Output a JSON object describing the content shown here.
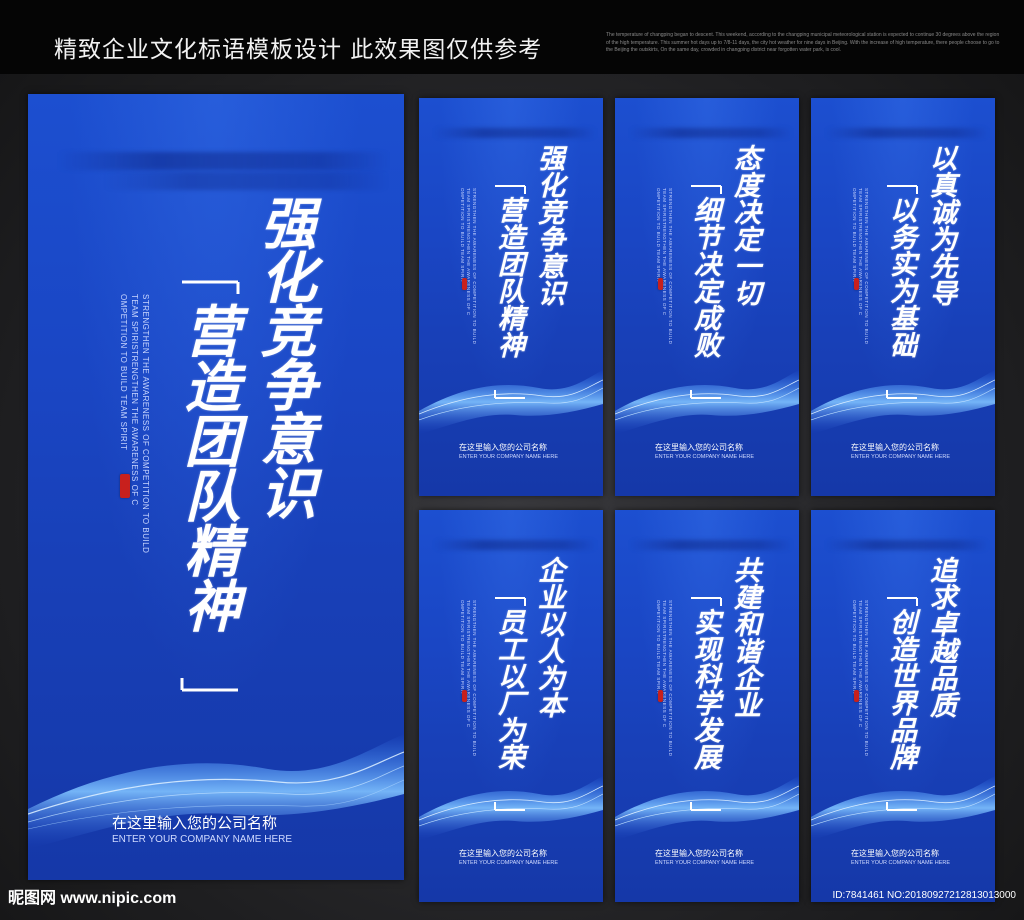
{
  "header": {
    "title": "精致企业文化标语模板设计 此效果图仅供参考",
    "fine_print": "The temperature of changping began to descent. This weekend, according to the changping municipal meteorological station is expected to continue 30 degrees above the region of the high temperature. This summer hot days up to 7/8-11 days, the city hot weather for nine days in Beijing. With the increase of high temperature, there people choose to go to the Beijing the outskirts, On the same day, crowded in changping district near forgotten water park, is cool."
  },
  "posters": [
    {
      "slogan_main": "强化竞争意识",
      "slogan_sub": "营造团队精神",
      "english_lines": [
        "STRENGTHEN THE AWARENESS OF COMPETITION TO BUILD",
        "TEAM SPIRISTRENGTHEN THE AWARENESS OF C",
        "OMPETITION TO BUILD TEAM SPIRIT"
      ],
      "company_cn": "在这里输入您的公司名称",
      "company_en": "ENTER YOUR COMPANY NAME HERE"
    },
    {
      "slogan_main": "强化竞争意识",
      "slogan_sub": "营造团队精神",
      "english_lines": [
        "STRENGTHEN THE AWARENESS OF COMPETITION TO BUILD",
        "TEAM SPIRISTRENGTHEN THE AWARENESS OF C",
        "OMPETITION TO BUILD TEAM SPIRIT"
      ],
      "company_cn": "在这里输入您的公司名称",
      "company_en": "ENTER YOUR COMPANY NAME HERE"
    },
    {
      "slogan_main": "态度决定一切",
      "slogan_sub": "细节决定成败",
      "english_lines": [
        "STRENGTHEN THE AWARENESS OF COMPETITION TO BUILD",
        "TEAM SPIRISTRENGTHEN THE AWARENESS OF C",
        "OMPETITION TO BUILD TEAM SPIRIT"
      ],
      "company_cn": "在这里输入您的公司名称",
      "company_en": "ENTER YOUR COMPANY NAME HERE"
    },
    {
      "slogan_main": "以真诚为先导",
      "slogan_sub": "以务实为基础",
      "english_lines": [
        "STRENGTHEN THE AWARENESS OF COMPETITION TO BUILD",
        "TEAM SPIRISTRENGTHEN THE AWARENESS OF C",
        "OMPETITION TO BUILD TEAM SPIRIT"
      ],
      "company_cn": "在这里输入您的公司名称",
      "company_en": "ENTER YOUR COMPANY NAME HERE"
    },
    {
      "slogan_main": "企业以人为本",
      "slogan_sub": "员工以厂为荣",
      "english_lines": [
        "STRENGTHEN THE AWARENESS OF COMPETITION TO BUILD",
        "TEAM SPIRISTRENGTHEN THE AWARENESS OF C",
        "OMPETITION TO BUILD TEAM SPIRIT"
      ],
      "company_cn": "在这里输入您的公司名称",
      "company_en": "ENTER YOUR COMPANY NAME HERE"
    },
    {
      "slogan_main": "共建和谐企业",
      "slogan_sub": "实现科学发展",
      "english_lines": [
        "STRENGTHEN THE AWARENESS OF COMPETITION TO BUILD",
        "TEAM SPIRISTRENGTHEN THE AWARENESS OF C",
        "OMPETITION TO BUILD TEAM SPIRIT"
      ],
      "company_cn": "在这里输入您的公司名称",
      "company_en": "ENTER YOUR COMPANY NAME HERE"
    },
    {
      "slogan_main": "追求卓越品质",
      "slogan_sub": "创造世界品牌",
      "english_lines": [
        "STRENGTHEN THE AWARENESS OF COMPETITION TO BUILD",
        "TEAM SPIRISTRENGTHEN THE AWARENESS OF C",
        "OMPETITION TO BUILD TEAM SPIRIT"
      ],
      "company_cn": "在这里输入您的公司名称",
      "company_en": "ENTER YOUR COMPANY NAME HERE"
    }
  ],
  "footer": {
    "logo_text": "昵图网 www.nipic.com",
    "id_text": "ID:7841461 NO:20180927212813013000"
  },
  "colors": {
    "poster_blue": "#1a46c4",
    "seal_red": "#c8201d",
    "header_bg": "#050505"
  }
}
